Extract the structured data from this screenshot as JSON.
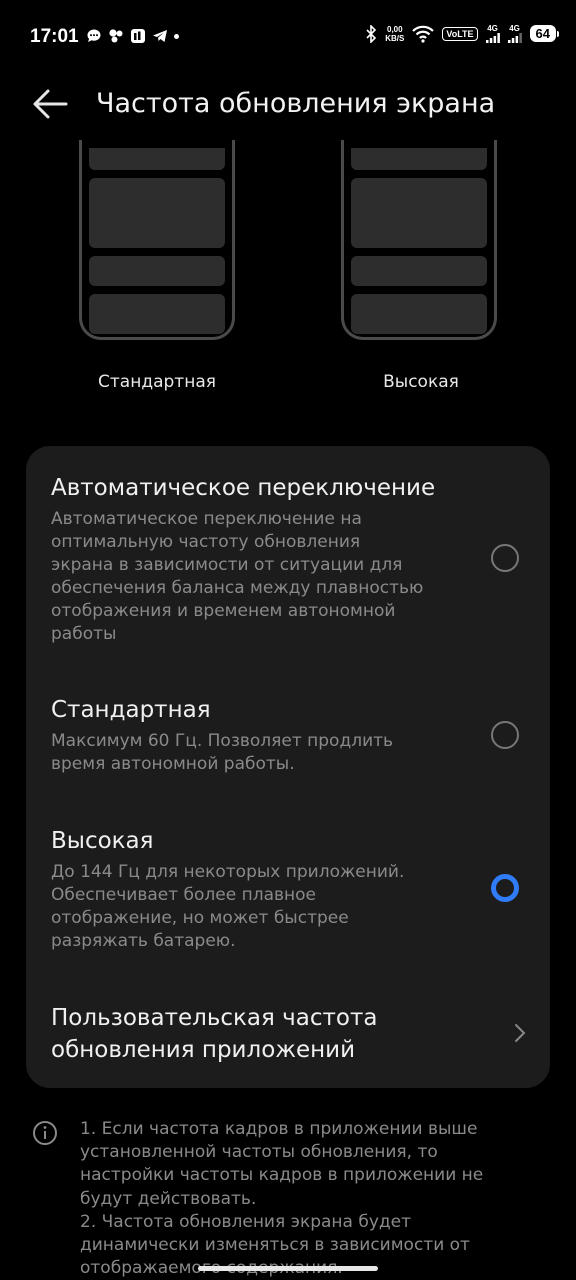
{
  "status_bar": {
    "time": "17:01",
    "speed_value": "0,00",
    "speed_unit": "KB/S",
    "volte": "VoLTE",
    "sim1": "4G",
    "sim2": "4G",
    "battery": "64"
  },
  "header": {
    "title": "Частота обновления экрана"
  },
  "previews": [
    {
      "label": "Стандартная"
    },
    {
      "label": "Высокая"
    }
  ],
  "options": [
    {
      "title": "Автоматическое переключение",
      "desc_lines": [
        "Автоматическое переключение на",
        "оптимальную частоту обновления",
        "экрана в зависимости от ситуации для",
        "обеспечения баланса между плавностью",
        "отображения и временем автономной",
        "работы"
      ],
      "selected": false
    },
    {
      "title": "Стандартная",
      "desc_lines": [
        "Максимум 60 Гц. Позволяет продлить",
        "время автономной работы."
      ],
      "selected": false
    },
    {
      "title": "Высокая",
      "desc_lines": [
        "До 144 Гц для некоторых приложений.",
        "Обеспечивает более плавное",
        "отображение, но может быстрее",
        "разряжать батарею."
      ],
      "selected": true
    }
  ],
  "custom_row": {
    "title_lines": [
      "Пользовательская частота",
      "обновления приложений"
    ]
  },
  "note": {
    "lines": [
      "1. Если частота кадров в приложении выше",
      "установленной частоты обновления, то",
      "настройки частоты кадров в приложении не",
      "будут действовать.",
      "2. Частота обновления экрана будет",
      "динамически изменяться в зависимости от",
      "отображаемого содержания."
    ]
  },
  "colors": {
    "accent": "#2f7cf6",
    "background": "#000000",
    "card": "#1c1c1c"
  }
}
